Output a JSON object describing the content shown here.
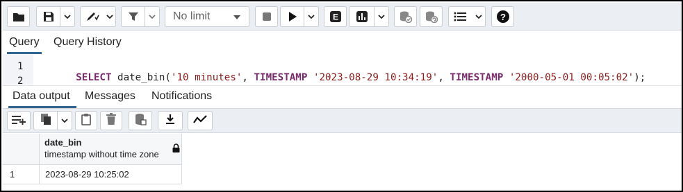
{
  "toolbar": {
    "buttons": [
      "folder-open-icon",
      "save-icon",
      "chevron-down-icon",
      "edit-icon",
      "chevron-down-icon",
      "filter-icon",
      "chevron-down-icon",
      "stop-icon",
      "execute-icon",
      "chevron-down-icon",
      "explain-icon",
      "explain-analyze-icon",
      "chevron-down-icon",
      "commit-icon",
      "rollback-icon",
      "macros-icon",
      "help-icon"
    ],
    "limit_value": "No limit",
    "explain_label": "E"
  },
  "query_tabs": [
    {
      "label": "Query",
      "active": true
    },
    {
      "label": "Query History",
      "active": false
    }
  ],
  "editor": {
    "line_numbers": [
      "1",
      "2"
    ],
    "code_tokens": [
      {
        "text": "SELECT",
        "kind": "kw"
      },
      {
        "text": " date_bin(",
        "kind": "fn"
      },
      {
        "text": "'10 minutes'",
        "kind": "str"
      },
      {
        "text": ", ",
        "kind": "fn"
      },
      {
        "text": "TIMESTAMP",
        "kind": "kw"
      },
      {
        "text": " ",
        "kind": "fn"
      },
      {
        "text": "'2023-08-29 10:34:19'",
        "kind": "str"
      },
      {
        "text": ", ",
        "kind": "fn"
      },
      {
        "text": "TIMESTAMP",
        "kind": "kw"
      },
      {
        "text": " ",
        "kind": "fn"
      },
      {
        "text": "'2000-05-01 00:05:02'",
        "kind": "str"
      },
      {
        "text": ");",
        "kind": "fn"
      }
    ]
  },
  "result_tabs": [
    {
      "label": "Data output",
      "active": true
    },
    {
      "label": "Messages",
      "active": false
    },
    {
      "label": "Notifications",
      "active": false
    }
  ],
  "result_toolbar": {
    "buttons": [
      "add-row-icon",
      "copy-icon",
      "chevron-down-icon",
      "paste-icon",
      "delete-icon",
      "save-data-icon",
      "download-icon",
      "graph-icon"
    ]
  },
  "grid": {
    "columns": [
      {
        "name": "date_bin",
        "type": "timestamp without time zone",
        "locked": true
      }
    ],
    "rows": [
      {
        "num": "1",
        "cells": [
          "2023-08-29 10:25:02"
        ]
      }
    ]
  },
  "colors": {
    "accent": "#326690",
    "toolbar_bg": "#ebeef3",
    "keyword": "#7a2b6e",
    "string": "#8b1a1a"
  }
}
